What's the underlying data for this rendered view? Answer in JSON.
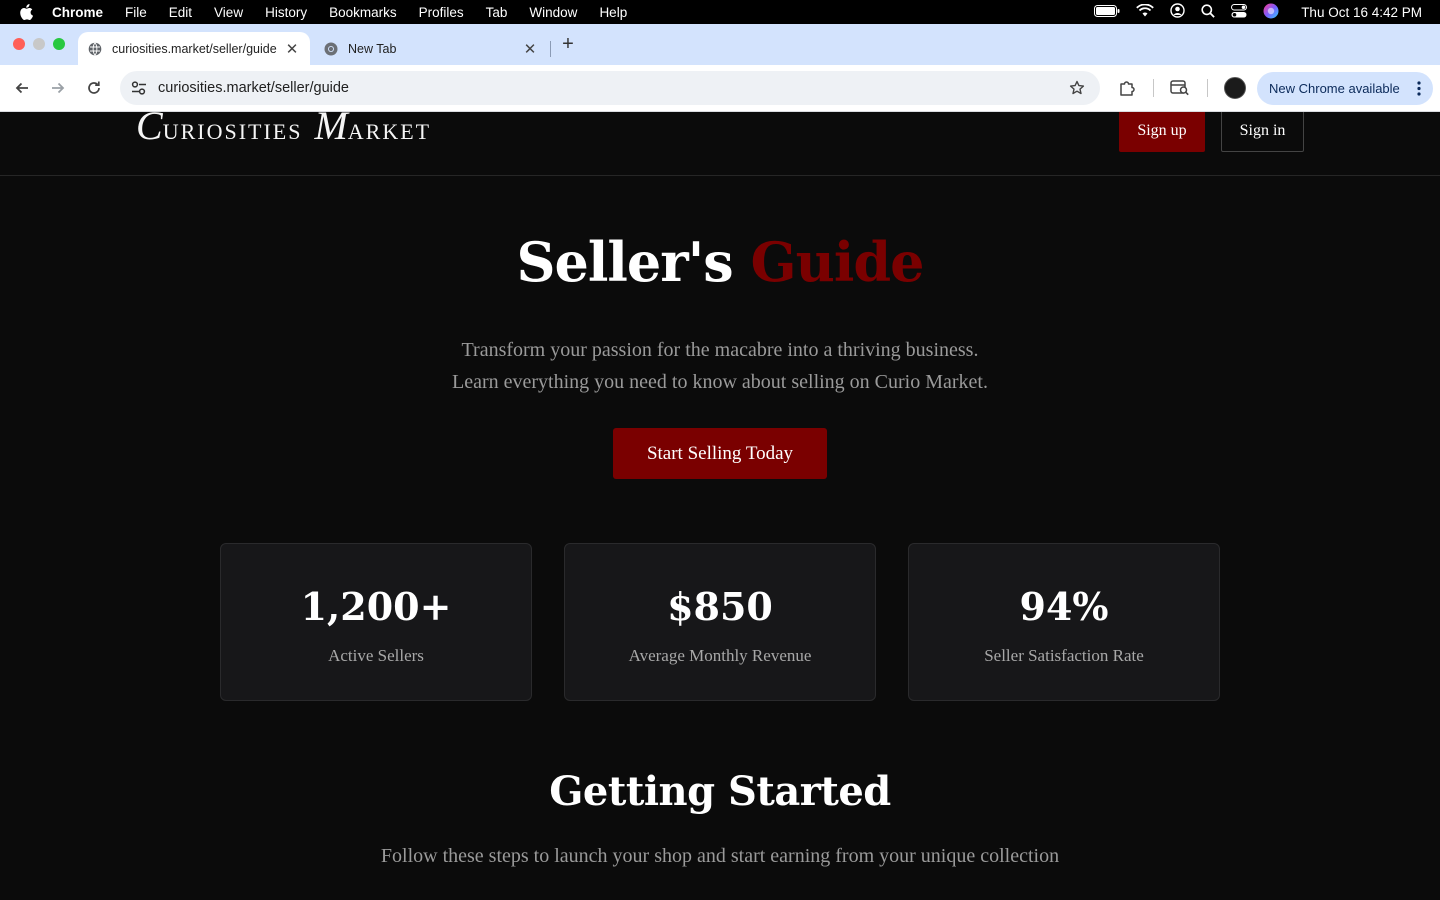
{
  "menubar": {
    "app_name": "Chrome",
    "items": [
      "File",
      "Edit",
      "View",
      "History",
      "Bookmarks",
      "Profiles",
      "Tab",
      "Window",
      "Help"
    ],
    "clock": "Thu Oct 16  4:42 PM"
  },
  "tabs": [
    {
      "title": "curiosities.market/seller/guide",
      "active": true
    },
    {
      "title": "New Tab",
      "active": false
    }
  ],
  "toolbar": {
    "url": "curiosities.market/seller/guide",
    "update_label": "New Chrome available"
  },
  "site": {
    "logo": {
      "first_cap": "C",
      "first_rest": "uriosities",
      "second_cap": "M",
      "second_rest": "arket"
    },
    "signup_label": "Sign up",
    "signin_label": "Sign in"
  },
  "hero": {
    "title_main": "Seller's",
    "title_accent": "Guide",
    "subtitle_line1": "Transform your passion for the macabre into a thriving business.",
    "subtitle_line2": "Learn everything you need to know about selling on Curio Market.",
    "cta_label": "Start Selling Today"
  },
  "stats": [
    {
      "value": "1,200+",
      "label": "Active Sellers"
    },
    {
      "value": "$850",
      "label": "Average Monthly Revenue"
    },
    {
      "value": "94%",
      "label": "Seller Satisfaction Rate"
    }
  ],
  "getting_started": {
    "title": "Getting Started",
    "subtitle": "Follow these steps to launch your shop and start earning from your unique collection"
  },
  "colors": {
    "accent": "#7a0000",
    "page_bg": "#0b0b0b",
    "card_bg": "#171719",
    "tabstrip_bg": "#d3e3fd"
  }
}
